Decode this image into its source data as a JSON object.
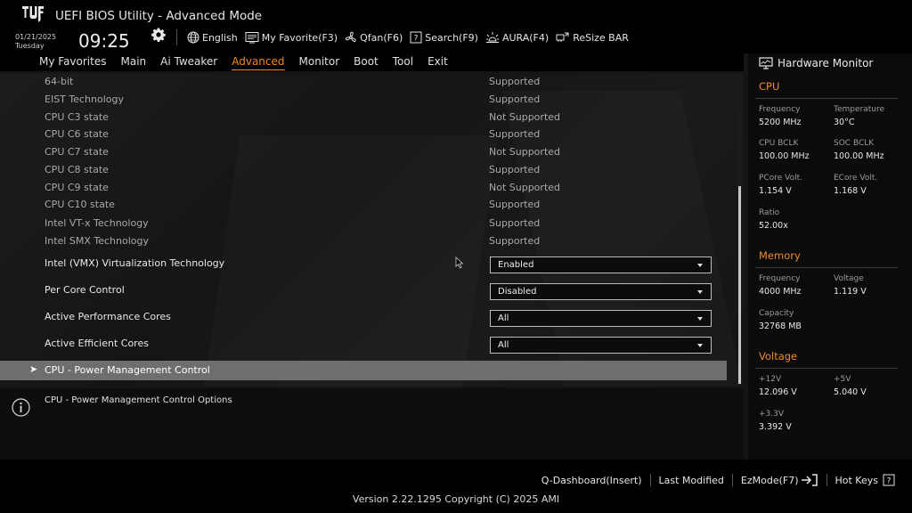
{
  "header": {
    "app_title": "UEFI BIOS Utility - Advanced Mode",
    "date": "01/21/2025",
    "weekday": "Tuesday",
    "time": "09:25",
    "toolbar": [
      {
        "label": "English",
        "icon": "globe-icon"
      },
      {
        "label": "My Favorite(F3)",
        "icon": "favorite-monitor-icon"
      },
      {
        "label": "Qfan(F6)",
        "icon": "fan-icon"
      },
      {
        "label": "Search(F9)",
        "icon": "search-question-icon"
      },
      {
        "label": "AURA(F4)",
        "icon": "aura-light-icon"
      },
      {
        "label": "ReSize BAR",
        "icon": "resize-bar-icon"
      }
    ]
  },
  "nav": {
    "tabs": [
      "My Favorites",
      "Main",
      "Ai Tweaker",
      "Advanced",
      "Monitor",
      "Boot",
      "Tool",
      "Exit"
    ],
    "active": "Advanced"
  },
  "settings": {
    "readonly": [
      {
        "label": "64-bit",
        "value": "Supported"
      },
      {
        "label": "EIST Technology",
        "value": "Supported"
      },
      {
        "label": "CPU C3 state",
        "value": "Not Supported"
      },
      {
        "label": "CPU C6 state",
        "value": "Supported"
      },
      {
        "label": "CPU C7 state",
        "value": "Not Supported"
      },
      {
        "label": "CPU C8 state",
        "value": "Supported"
      },
      {
        "label": "CPU C9 state",
        "value": "Not Supported"
      },
      {
        "label": "CPU C10 state",
        "value": "Supported"
      },
      {
        "label": "Intel VT-x Technology",
        "value": "Supported"
      },
      {
        "label": "Intel SMX Technology",
        "value": "Supported"
      }
    ],
    "editable": [
      {
        "label": "Intel (VMX) Virtualization Technology",
        "value": "Enabled"
      },
      {
        "label": "Per Core Control",
        "value": "Disabled"
      },
      {
        "label": "Active Performance Cores",
        "value": "All"
      },
      {
        "label": "Active Efficient Cores",
        "value": "All"
      }
    ],
    "submenu": {
      "label": "CPU - Power Management Control"
    }
  },
  "help": {
    "text": "CPU - Power Management Control Options"
  },
  "hardware_monitor": {
    "title": "Hardware Monitor",
    "cpu": {
      "title": "CPU",
      "frequency_label": "Frequency",
      "frequency": "5200 MHz",
      "temperature_label": "Temperature",
      "temperature": "30°C",
      "bclk_label": "CPU BCLK",
      "bclk": "100.00 MHz",
      "soc_bclk_label": "SOC BCLK",
      "soc_bclk": "100.00 MHz",
      "pcore_label": "PCore Volt.",
      "pcore": "1.154 V",
      "ecore_label": "ECore Volt.",
      "ecore": "1.168 V",
      "ratio_label": "Ratio",
      "ratio": "52.00x"
    },
    "memory": {
      "title": "Memory",
      "frequency_label": "Frequency",
      "frequency": "4000 MHz",
      "voltage_label": "Voltage",
      "voltage": "1.119 V",
      "capacity_label": "Capacity",
      "capacity": "32768 MB"
    },
    "voltage": {
      "title": "Voltage",
      "v12_label": "+12V",
      "v12": "12.096 V",
      "v5_label": "+5V",
      "v5": "5.040 V",
      "v33_label": "+3.3V",
      "v33": "3.392 V"
    }
  },
  "footer": {
    "links": [
      "Q-Dashboard(Insert)",
      "Last Modified",
      "EzMode(F7)",
      "Hot Keys"
    ],
    "version": "Version 2.22.1295 Copyright (C) 2025 AMI"
  },
  "colors": {
    "accent": "#f08a24",
    "highlight": "#6e6e6e",
    "background": "#141414"
  }
}
